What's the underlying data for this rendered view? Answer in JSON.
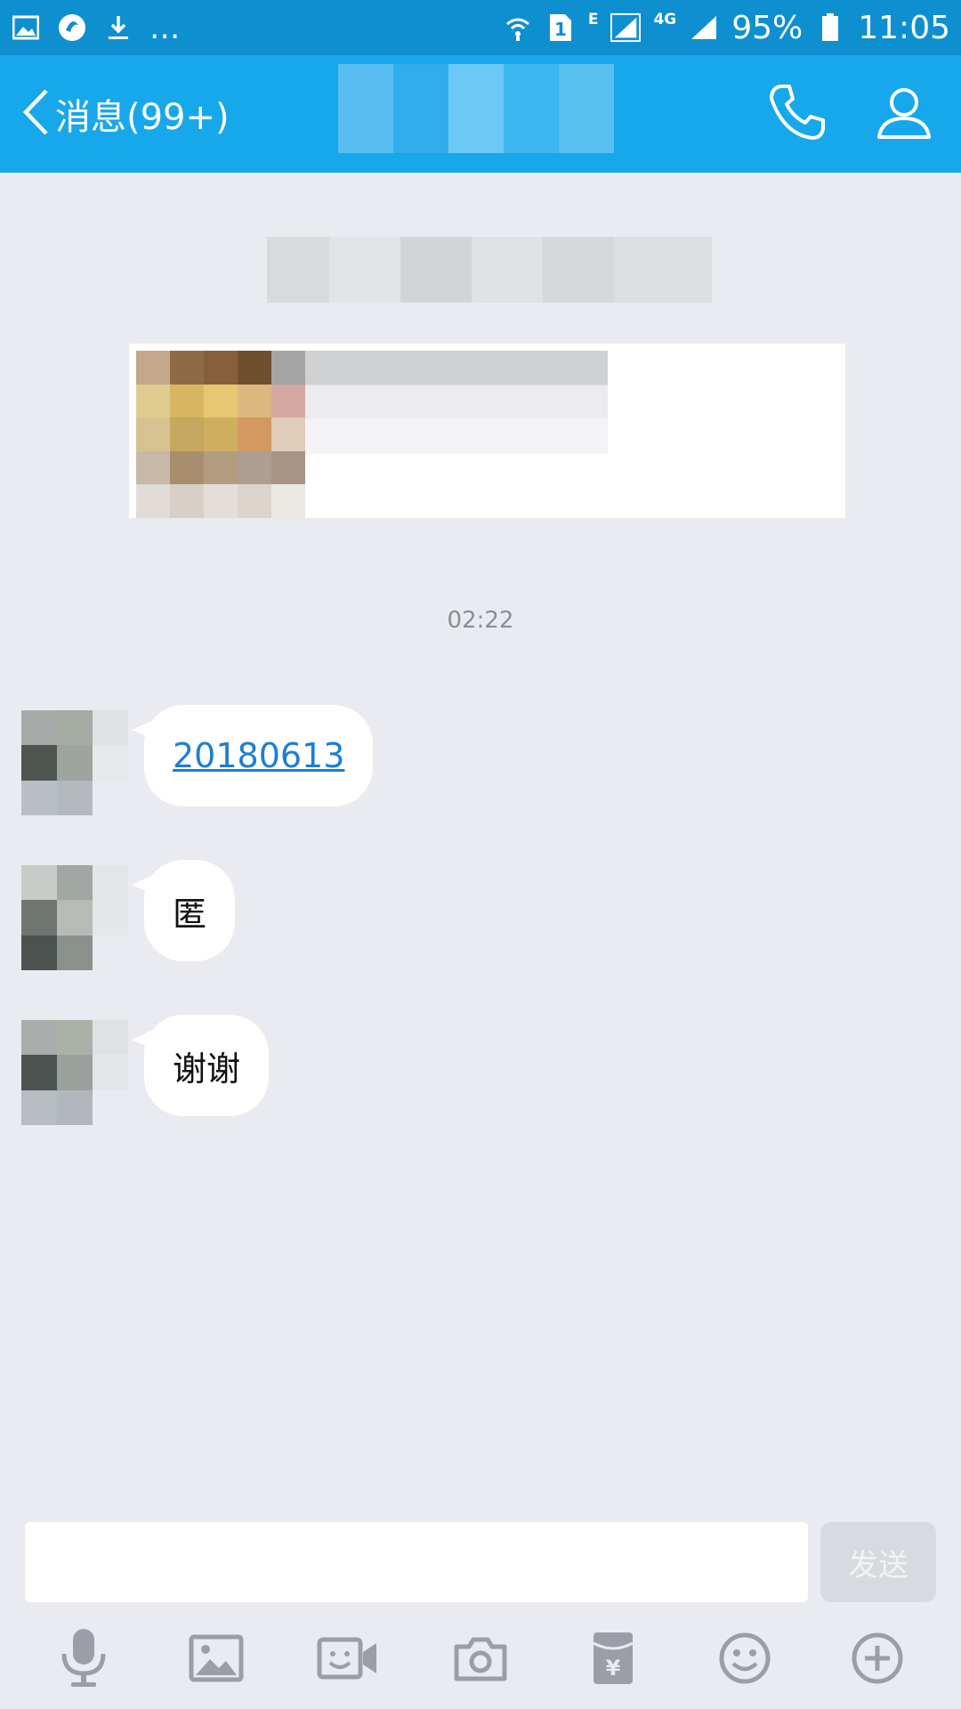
{
  "status_bar": {
    "dots": "...",
    "net_e": "E",
    "net_4g": "4G",
    "battery": "95%",
    "time": "11:05"
  },
  "header": {
    "back_label": "消息(99+)"
  },
  "chat": {
    "timestamp": "02:22",
    "messages": [
      {
        "text": "20180613",
        "is_link": true
      },
      {
        "text": "匿"
      },
      {
        "text": "谢谢"
      }
    ]
  },
  "input": {
    "value": "",
    "send_label": "发送"
  },
  "toolbar": {
    "icons": [
      "microphone-icon",
      "image-icon",
      "video-call-icon",
      "camera-icon",
      "red-packet-icon",
      "emoji-icon",
      "plus-icon"
    ]
  },
  "colors": {
    "title_bar": "#16a8ea",
    "status_bar": "#0e8fd0",
    "chat_bg": "#e9ebf0",
    "link": "#1c7fd3"
  }
}
